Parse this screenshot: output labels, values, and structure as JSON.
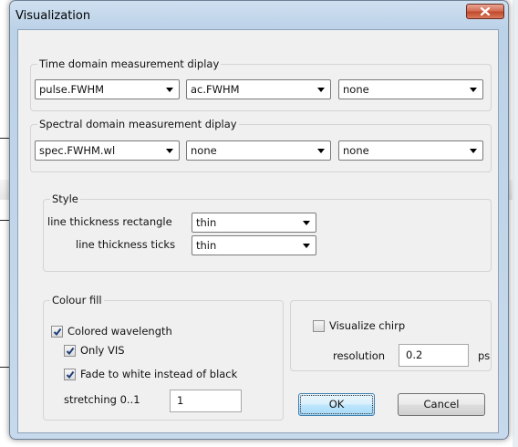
{
  "window": {
    "title": "Visualization"
  },
  "time_domain": {
    "label": "Time domain measurement diplay",
    "selects": [
      "pulse.FWHM",
      "ac.FWHM",
      "none"
    ]
  },
  "spectral_domain": {
    "label": "Spectral domain measurement diplay",
    "selects": [
      "spec.FWHM.wl",
      "none",
      "none"
    ]
  },
  "style": {
    "label": "Style",
    "rect_label": "line thickness rectangle",
    "rect_value": "thin",
    "ticks_label": "line thickness ticks",
    "ticks_value": "thin"
  },
  "colour_fill": {
    "label": "Colour fill",
    "colored_wavelength": {
      "label": "Colored wavelength",
      "checked": true
    },
    "only_vis": {
      "label": "Only VIS",
      "checked": true
    },
    "fade_white": {
      "label": "Fade to white instead of black",
      "checked": true
    },
    "stretching_label": "stretching 0..1",
    "stretching_value": "1"
  },
  "chirp": {
    "label": "Visualize chirp",
    "checked": false,
    "resolution_label": "resolution",
    "resolution_value": "0.2",
    "unit": "ps"
  },
  "buttons": {
    "ok": "OK",
    "cancel": "Cancel"
  }
}
